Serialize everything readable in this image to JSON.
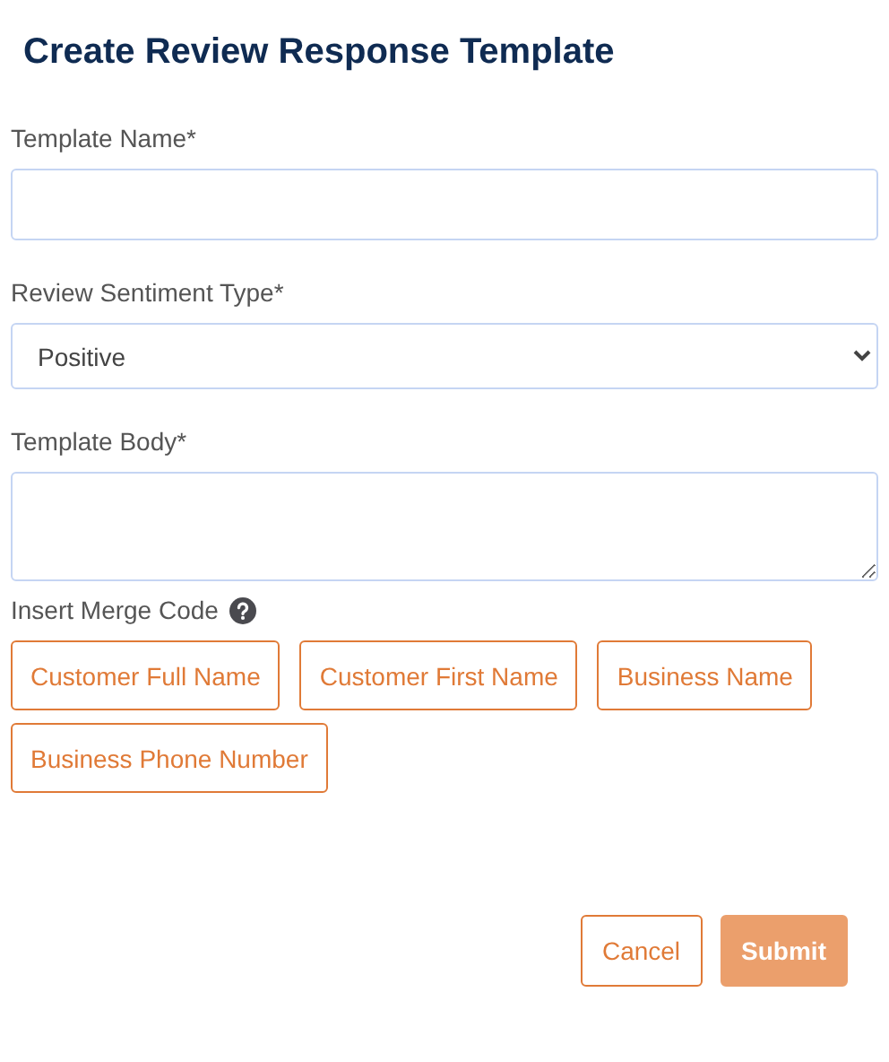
{
  "title": "Create Review Response Template",
  "fields": [
    {
      "kind": "text",
      "label": "Template Name*"
    },
    {
      "kind": "select",
      "label": "Review Sentiment Type*",
      "value": "Positive"
    },
    {
      "kind": "textarea",
      "label": "Template Body*"
    }
  ],
  "merge_codes": {
    "label": "Insert Merge Code",
    "buttons": [
      "Customer Full Name",
      "Customer First Name",
      "Business Name",
      "Business Phone Number"
    ]
  },
  "actions": [
    {
      "kind": "secondary",
      "label": "Cancel",
      "disabled": false
    },
    {
      "kind": "primary",
      "label": "Submit",
      "disabled": true
    }
  ]
}
